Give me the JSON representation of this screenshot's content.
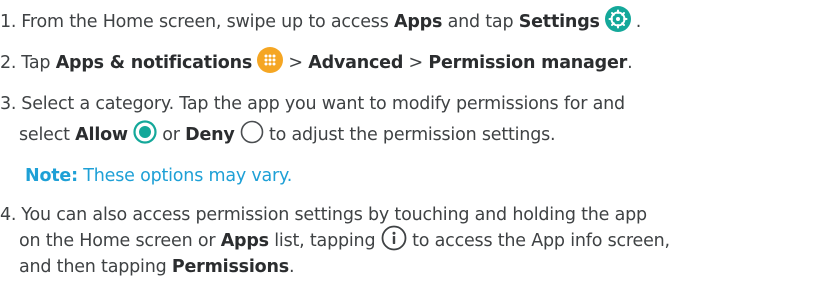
{
  "steps": [
    {
      "number": "1.",
      "text_a": "From the Home screen, swipe up to access ",
      "bold_a": "Apps",
      "text_b": " and tap ",
      "bold_b": "Settings",
      "icon": "settings-gear-icon",
      "text_c": "."
    },
    {
      "number": "2.",
      "text_a": "Tap ",
      "bold_a": "Apps & notifications",
      "icon": "apps-grid-icon",
      "sep1": " > ",
      "bold_b": "Advanced",
      "sep2": " > ",
      "bold_c": "Permission manager",
      "text_end": "."
    },
    {
      "number": "3.",
      "line1": "Select a category. Tap the app you want to modify permissions for and",
      "text_a": "select ",
      "bold_a": "Allow",
      "allow_icon": "radio-selected-icon",
      "text_b": " or ",
      "bold_b": "Deny",
      "deny_icon": "radio-unselected-icon",
      "text_c": " to adjust the permission settings."
    },
    {
      "number": "4.",
      "line1": "You can also access permission settings by touching and holding the app",
      "line2_a": "on the Home screen or ",
      "line2_bold": "Apps",
      "line2_b": " list, tapping ",
      "info_icon": "info-icon",
      "line2_c": " to access the App info screen,",
      "line3_a": "and then tapping ",
      "line3_bold": "Permissions",
      "line3_b": "."
    }
  ],
  "note": {
    "label": "Note:",
    "text": " These options may vary."
  },
  "colors": {
    "text": "#3f4244",
    "note": "#1ea0d6",
    "settings_icon_bg": "#14a89a",
    "apps_icon_bg": "#f5a623",
    "radio_accent": "#14a89a"
  }
}
